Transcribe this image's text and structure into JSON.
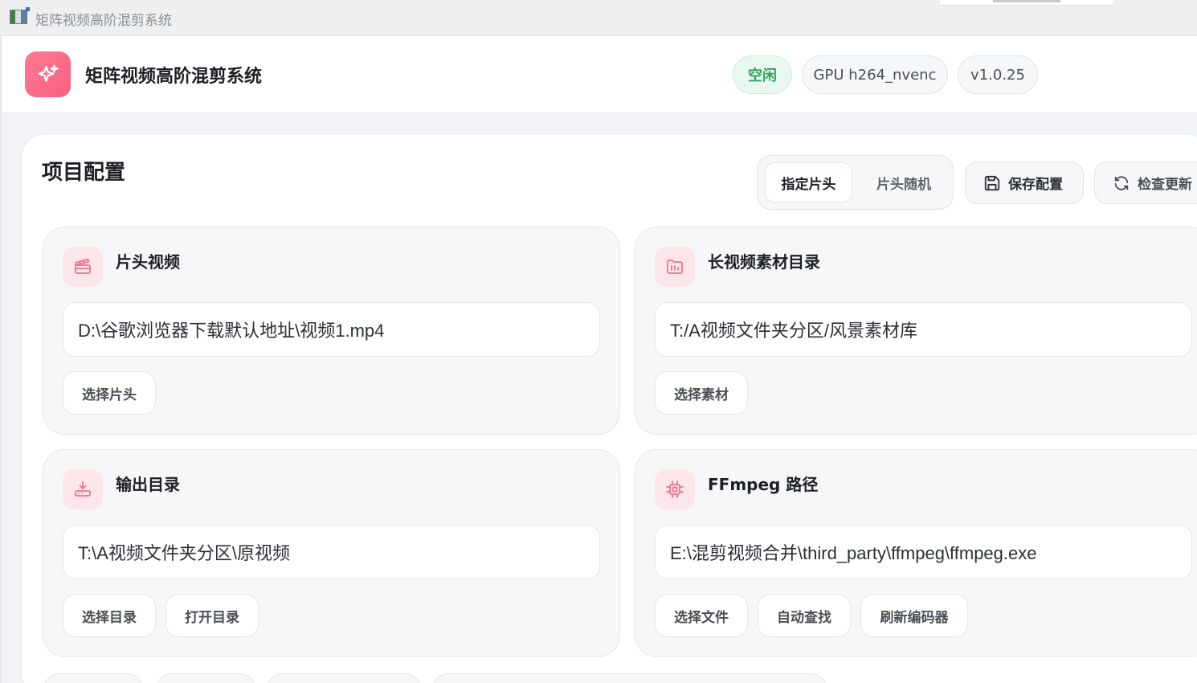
{
  "window": {
    "title": "矩阵视频高阶混剪系统"
  },
  "header": {
    "app_name": "矩阵视频高阶混剪系统",
    "logo_icon": "sparkle-icon",
    "status": "空闲",
    "gpu": "GPU h264_nvenc",
    "version": "v1.0.25"
  },
  "panel": {
    "title": "项目配置",
    "segment": {
      "options": [
        "指定片头",
        "片头随机"
      ],
      "selected": "指定片头"
    },
    "save_label": "保存配置",
    "check_update_label": "检查更新"
  },
  "cards": [
    {
      "title": "片头视频",
      "icon": "clapperboard-icon",
      "value": "D:\\谷歌浏览器下载默认地址\\视频1.mp4",
      "buttons": [
        "选择片头"
      ]
    },
    {
      "title": "长视频素材目录",
      "icon": "folder-icon",
      "value": "T:/A视频文件夹分区/风景素材库",
      "buttons": [
        "选择素材"
      ]
    },
    {
      "title": "输出目录",
      "icon": "download-icon",
      "value": "T:\\A视频文件夹分区\\原视频",
      "buttons": [
        "选择目录",
        "打开目录"
      ]
    },
    {
      "title": "FFmpeg 路径",
      "icon": "chip-icon",
      "value": "E:\\混剪视频合并\\third_party\\ffmpeg\\ffmpeg.exe",
      "buttons": [
        "选择文件",
        "自动查找",
        "刷新编码器"
      ]
    }
  ],
  "colors": {
    "accent": "#f8607f",
    "status_green": "#2ea365"
  }
}
